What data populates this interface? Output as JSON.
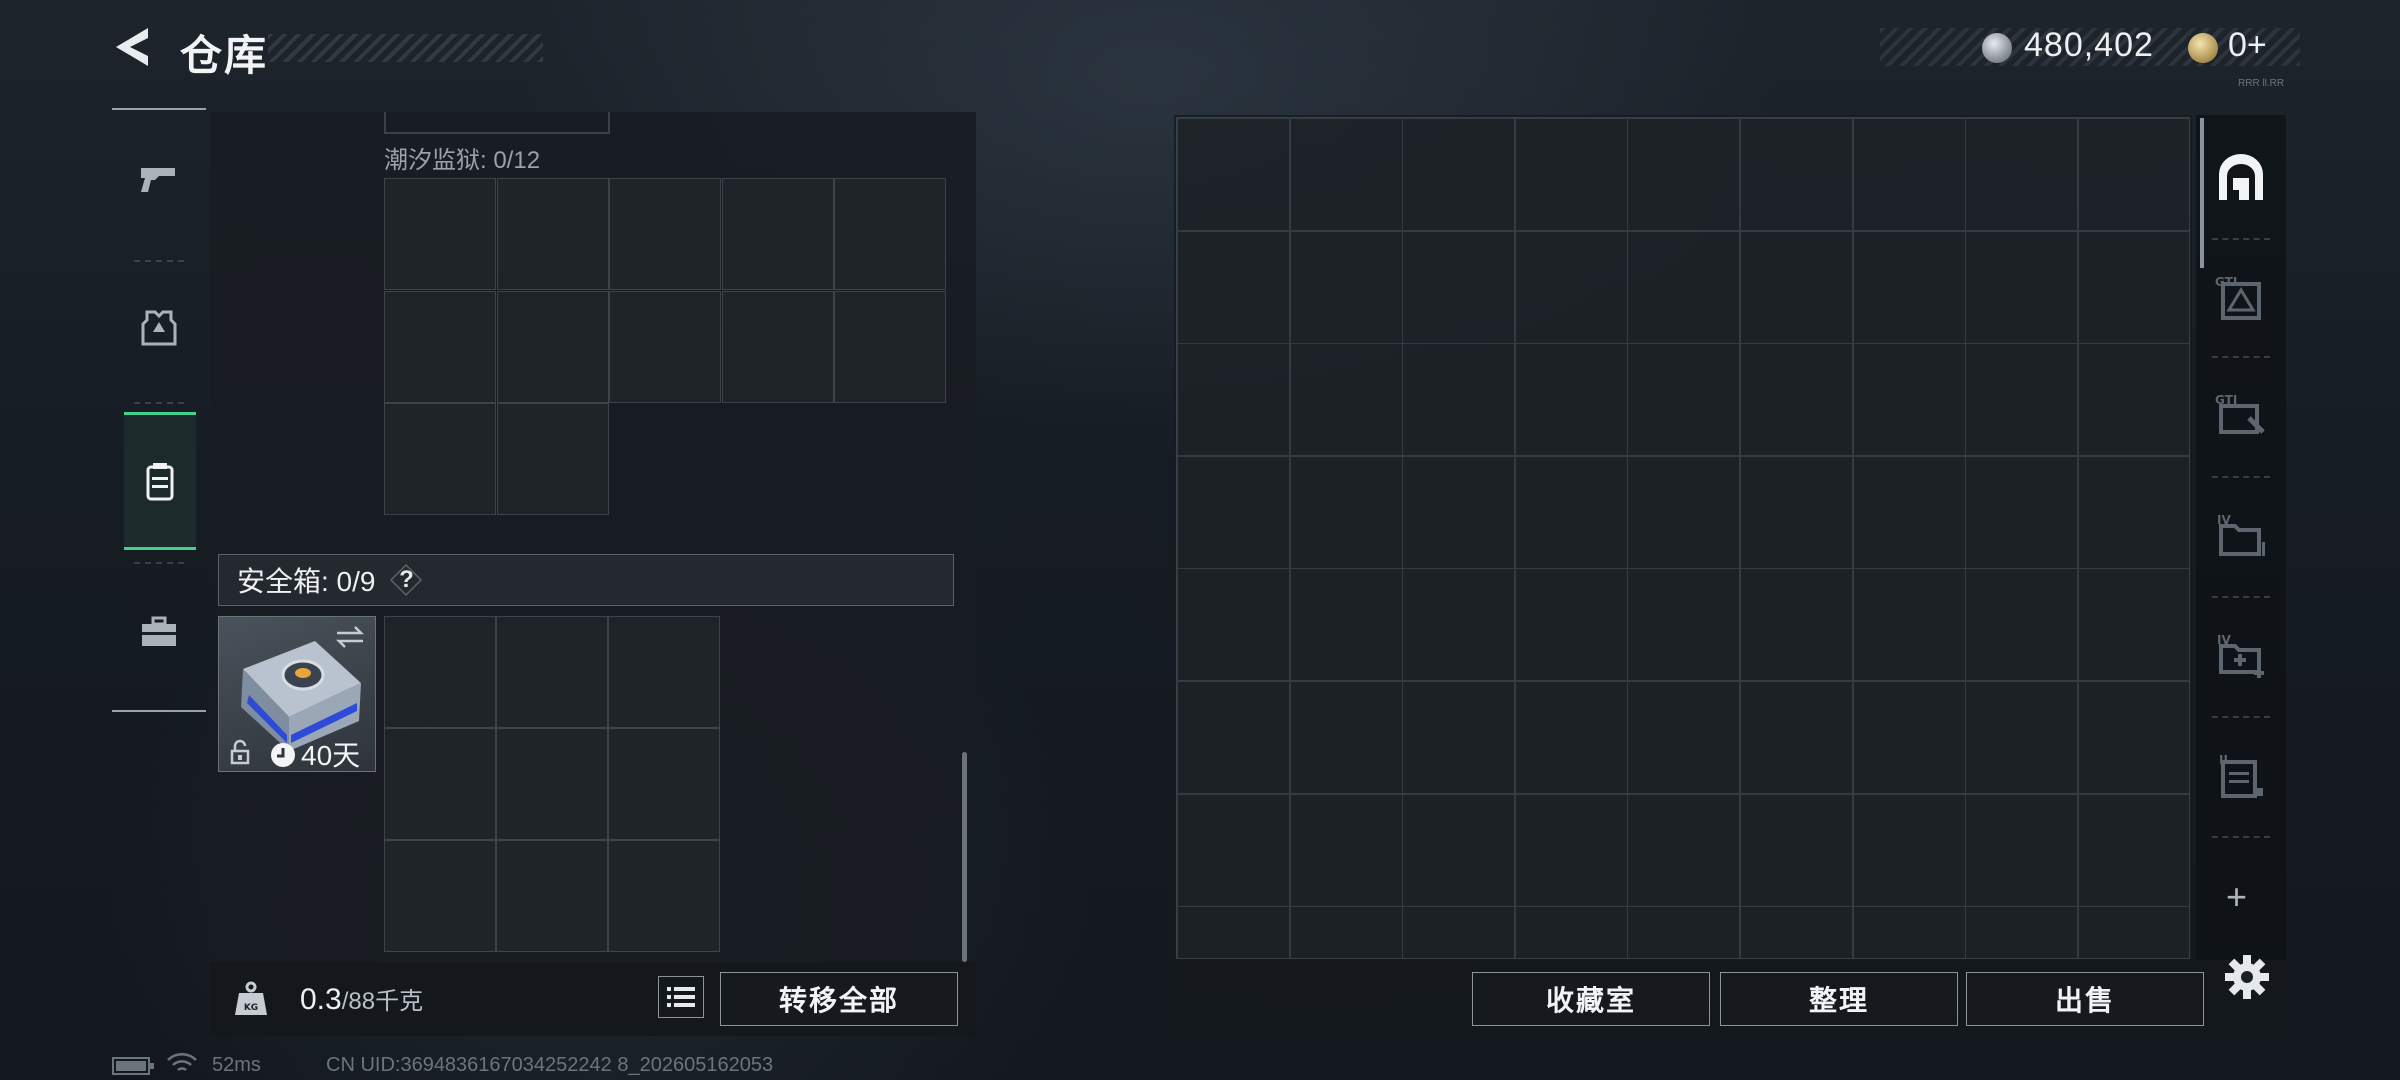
{
  "header": {
    "title": "仓库",
    "currency_amount": "480,402",
    "premium_amount": "0+",
    "tiny_mark": "RRR ll.RR"
  },
  "sidebar": {
    "items": [
      {
        "name": "weapons",
        "icon": "pistol-icon"
      },
      {
        "name": "armor",
        "icon": "armor-vest-icon"
      },
      {
        "name": "backpack",
        "icon": "backpack-icon",
        "active": true
      },
      {
        "name": "toolbox",
        "icon": "toolbox-icon"
      }
    ]
  },
  "left": {
    "container_label": "潮汐监狱: 0/12",
    "safebox_label": "安全箱: 0/9",
    "safebox_help": "?",
    "safebox_days": "40天",
    "weight_value": "0.3",
    "weight_max": "/88千克",
    "transfer_all_label": "转移全部"
  },
  "right": {
    "collection_label": "收藏室",
    "sort_label": "整理",
    "sell_label": "出售",
    "plus_label": "+"
  },
  "status": {
    "ping": "52ms",
    "uid": "CN UID:3694836167034252242 8_202605162053"
  },
  "colors": {
    "accent_green": "#3fd38e",
    "panel_bg": "#181d22",
    "grid_border": "#3c434a"
  }
}
